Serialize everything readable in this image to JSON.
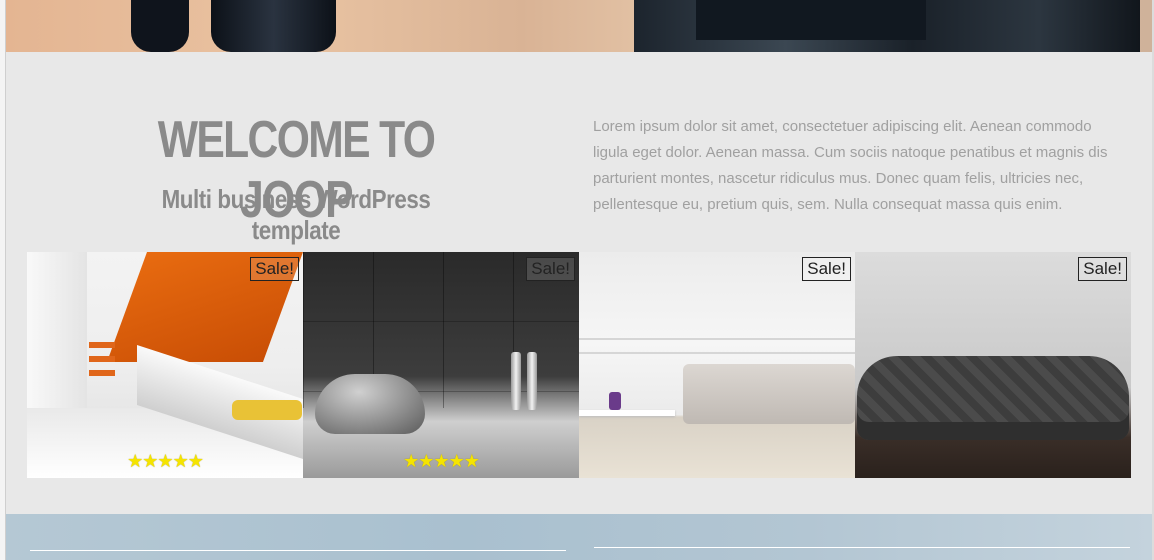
{
  "welcome": {
    "title": "WELCOME TO JOOP",
    "subtitle": "Multi business WordPress template",
    "description": "Lorem ipsum dolor sit amet, consectetuer adipiscing elit. Aenean commodo ligula eget dolor. Aenean massa. Cum sociis natoque penatibus et magnis dis parturient montes, nascetur ridiculus mus. Donec quam felis, ultricies nec, pellentesque eu, pretium quis, sem. Nulla consequat massa quis enim."
  },
  "products": [
    {
      "badge": "Sale!",
      "rating": 5,
      "stars": "★★★★★",
      "image": "orange-interior-image"
    },
    {
      "badge": "Sale!",
      "rating": 5,
      "stars": "★★★★★",
      "image": "dark-room-chair-image"
    },
    {
      "badge": "Sale!",
      "image": "beige-sofa-image"
    },
    {
      "badge": "Sale!",
      "image": "leather-sofa-image"
    }
  ],
  "colors": {
    "panel_bg": "#e8e8e8",
    "heading": "#8a8a8a",
    "star": "#f5e400",
    "footer_band": "#aec3d0"
  }
}
